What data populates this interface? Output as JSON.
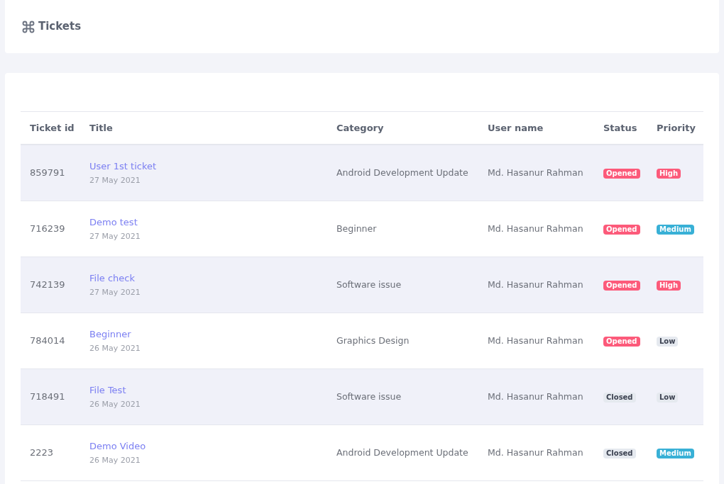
{
  "header": {
    "title": "Tickets"
  },
  "table": {
    "columns": [
      "Ticket id",
      "Title",
      "Category",
      "User name",
      "Status",
      "Priority"
    ],
    "rows": [
      {
        "id": "859791",
        "title": "User 1st ticket",
        "date": "27 May 2021",
        "category": "Android Development Update",
        "user": "Md. Hasanur Rahman",
        "status": {
          "label": "Opened",
          "kind": "danger"
        },
        "priority": {
          "label": "High",
          "kind": "danger"
        }
      },
      {
        "id": "716239",
        "title": "Demo test",
        "date": "27 May 2021",
        "category": "Beginner",
        "user": "Md. Hasanur Rahman",
        "status": {
          "label": "Opened",
          "kind": "danger"
        },
        "priority": {
          "label": "Medium",
          "kind": "info"
        }
      },
      {
        "id": "742139",
        "title": "File check",
        "date": "27 May 2021",
        "category": "Software issue",
        "user": "Md. Hasanur Rahman",
        "status": {
          "label": "Opened",
          "kind": "danger"
        },
        "priority": {
          "label": "High",
          "kind": "danger"
        }
      },
      {
        "id": "784014",
        "title": "Beginner",
        "date": "26 May 2021",
        "category": "Graphics Design",
        "user": "Md. Hasanur Rahman",
        "status": {
          "label": "Opened",
          "kind": "danger"
        },
        "priority": {
          "label": "Low",
          "kind": "light"
        }
      },
      {
        "id": "718491",
        "title": "File Test",
        "date": "26 May 2021",
        "category": "Software issue",
        "user": "Md. Hasanur Rahman",
        "status": {
          "label": "Closed",
          "kind": "light"
        },
        "priority": {
          "label": "Low",
          "kind": "light"
        }
      },
      {
        "id": "2223",
        "title": "Demo Video",
        "date": "26 May 2021",
        "category": "Android Development Update",
        "user": "Md. Hasanur Rahman",
        "status": {
          "label": "Closed",
          "kind": "light"
        },
        "priority": {
          "label": "Medium",
          "kind": "info"
        }
      }
    ]
  }
}
